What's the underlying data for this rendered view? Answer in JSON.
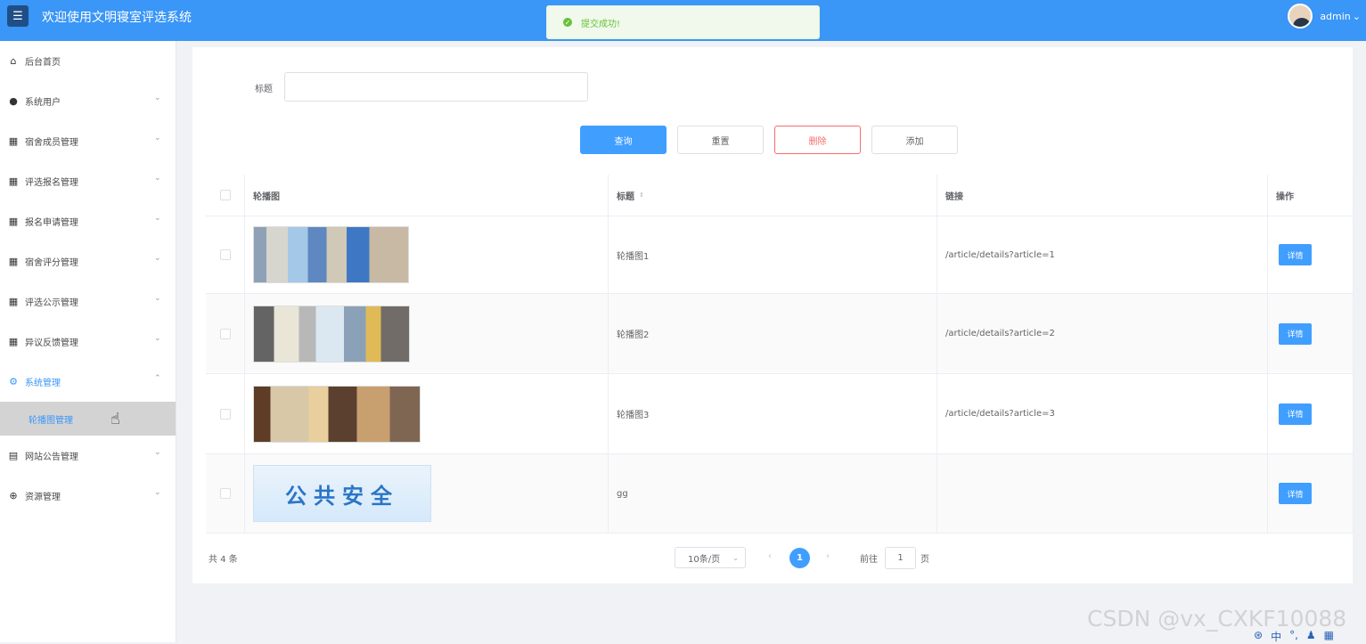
{
  "topbar": {
    "menu_icon": "☰",
    "title": "欢迎使用文明寝室评选系统",
    "toast": "提交成功!",
    "user_name": "admin",
    "user_caret": "⌄"
  },
  "sidebar": {
    "items": [
      {
        "label": "后台首页",
        "icon": "home-icon"
      },
      {
        "label": "系统用户",
        "icon": "user-icon"
      },
      {
        "label": "宿舍成员管理",
        "icon": "grid-icon"
      },
      {
        "label": "评选报名管理",
        "icon": "grid-icon"
      },
      {
        "label": "报名申请管理",
        "icon": "grid-icon"
      },
      {
        "label": "宿舍评分管理",
        "icon": "grid-icon"
      },
      {
        "label": "评选公示管理",
        "icon": "grid-icon"
      },
      {
        "label": "异议反馈管理",
        "icon": "grid-icon"
      },
      {
        "label": "系统管理",
        "icon": "settings-icon"
      },
      {
        "label": "网站公告管理",
        "icon": "document-icon"
      },
      {
        "label": "资源管理",
        "icon": "plus-circle-icon"
      }
    ],
    "sub_item": "轮播图管理"
  },
  "search": {
    "label": "标题",
    "value": ""
  },
  "buttons": {
    "query": "查询",
    "reset": "重置",
    "delete": "删除",
    "add": "添加"
  },
  "table": {
    "headers": [
      "轮播图",
      "标题",
      "链接",
      "操作"
    ],
    "sort_icon": "⇕",
    "rows": [
      {
        "title": "轮播图1",
        "link": "/article/details?article=1",
        "action": "详情"
      },
      {
        "title": "轮播图2",
        "link": "/article/details?article=2",
        "action": "详情"
      },
      {
        "title": "轮播图3",
        "link": "/article/details?article=3",
        "action": "详情"
      },
      {
        "title": "gg",
        "link": "",
        "action": "详情",
        "poster_text": "公共安全"
      }
    ]
  },
  "pagination": {
    "total": "共 4 条",
    "page_size": "10条/页",
    "current_page": "1",
    "goto_prefix": "前往",
    "goto_value": "1",
    "goto_suffix": "页"
  },
  "watermark": "CSDN @vx_CXKF10088",
  "tray": [
    "⊛",
    "中",
    "°,",
    "♟",
    "▦"
  ],
  "colors": {
    "topbar": "#3a96f7",
    "primary": "#409eff",
    "danger": "#f56c6c",
    "success": "#67c23a"
  }
}
